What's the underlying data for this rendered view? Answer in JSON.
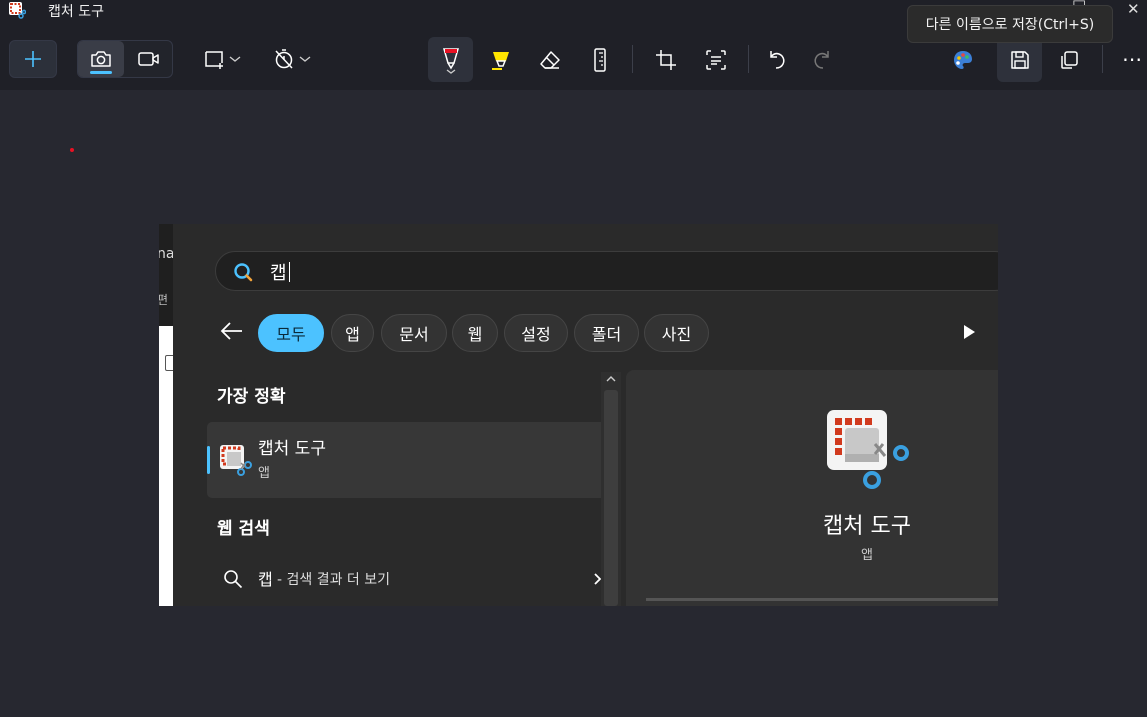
{
  "window": {
    "title": "캡처 도구",
    "app_icon": "snipping-tool-icon",
    "minimize_glyph": "□",
    "close_glyph": "✕"
  },
  "toolbar": {
    "new_icon": "plus-icon",
    "modes": [
      "camera-icon",
      "video-camera-icon"
    ],
    "shape_dropdown": "rectangle-snip-icon",
    "timer_dropdown": "no-timer-icon",
    "tools": [
      "ballpoint-pen-icon",
      "highlighter-icon",
      "eraser-icon",
      "ruler-icon",
      "crop-icon",
      "text-actions-icon",
      "undo-icon",
      "redo-icon"
    ],
    "right_tools": [
      "paint-palette-icon",
      "save-icon",
      "copy-icon",
      "more-icon"
    ],
    "more_glyph": "⋯",
    "accent_color": "#4cc2ff"
  },
  "tooltip": {
    "text": "다른 이름으로 저장(Ctrl+S)"
  },
  "capture": {
    "left_strip": {
      "text1": "na",
      "text2": "편"
    },
    "search": {
      "value": "캡"
    },
    "filters": [
      "모두",
      "앱",
      "문서",
      "웹",
      "설정",
      "폴더",
      "사진"
    ],
    "active_filter": "모두",
    "sections": {
      "best_match": "가장 정확",
      "web_search": "웹 검색"
    },
    "best_match_item": {
      "title": "캡처 도구",
      "subtitle": "앱"
    },
    "web_item": {
      "query": "캡",
      "suffix": " - 검색 결과 더 보기"
    },
    "detail": {
      "title": "캡처 도구",
      "subtitle": "앱"
    }
  }
}
